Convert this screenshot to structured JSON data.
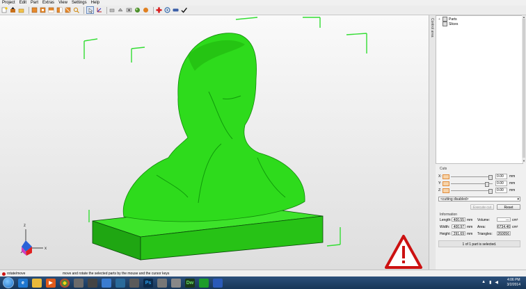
{
  "menu": [
    "Project",
    "Edit",
    "Part",
    "Extras",
    "View",
    "Settings",
    "Help"
  ],
  "toolbar": {
    "icons": [
      "new-project-icon",
      "import-part-icon",
      "open-icon",
      "rotate-view-icon",
      "top-view-icon",
      "front-view-icon",
      "side-view-icon",
      "iso-view-icon",
      "zoom-icon",
      "select-icon",
      "move-icon",
      "scale-icon",
      "mirror-icon",
      "pan-icon",
      "measure-icon",
      "add-part-icon",
      "repair-icon",
      "slice-icon",
      "check-icon"
    ]
  },
  "sidebar_tab": "Control area",
  "tree": {
    "items": [
      {
        "label": "Parts"
      },
      {
        "label": "Slices"
      }
    ]
  },
  "cuts": {
    "title": "Cuts",
    "rows": [
      {
        "axis": "X:",
        "value": "0.00",
        "unit": "mm",
        "knob": 0.96
      },
      {
        "axis": "Y:",
        "value": "0.00",
        "unit": "mm",
        "knob": 0.87
      },
      {
        "axis": "Z:",
        "value": "0.00",
        "unit": "mm",
        "knob": 0.96
      }
    ],
    "mode": "<cutting disabled>",
    "execute_label": "Execute cut",
    "reset_label": "Reset"
  },
  "information": {
    "title": "Information",
    "length_label": "Length:",
    "length_value": "400.55",
    "length_unit": "mm",
    "width_label": "Width:",
    "width_value": "400.97",
    "width_unit": "mm",
    "height_label": "Height:",
    "height_value": "291.69",
    "height_unit": "mm",
    "volume_label": "Volume:",
    "volume_value": "---",
    "volume_unit": "cm³",
    "area_label": "Area:",
    "area_value": "6734.46",
    "area_unit": "cm²",
    "triangles_label": "Triangles:",
    "triangles_value": "260056"
  },
  "selection_status": "1 of 1 part is selected.",
  "status": {
    "mode": "rotate/move",
    "hint": "move and rotate the selected parts by the mouse and the cursor keys"
  },
  "clock": {
    "time": "4:06 PM",
    "date": "3/2/2014"
  },
  "axes": {
    "z": "z",
    "x": "x"
  },
  "colors": {
    "model": "#22cc11",
    "bbox": "#33dd33",
    "warning": "#cc1111"
  }
}
